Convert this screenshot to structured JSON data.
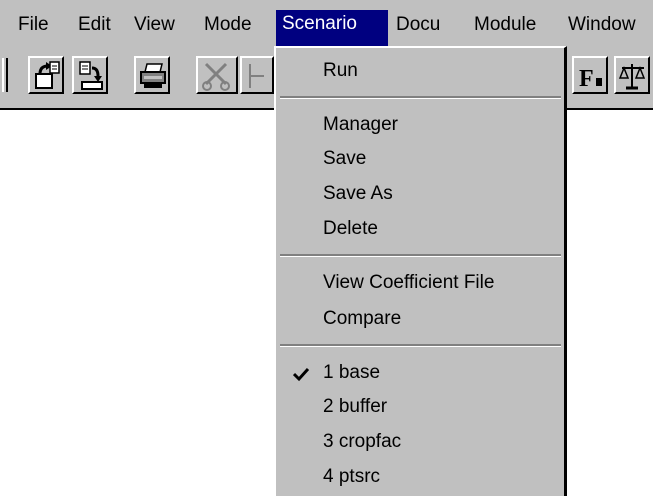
{
  "menubar": {
    "items": [
      {
        "label": "File"
      },
      {
        "label": "Edit"
      },
      {
        "label": "View"
      },
      {
        "label": "Mode"
      },
      {
        "label": "Scenario"
      },
      {
        "label": "Docu"
      },
      {
        "label": "Module"
      },
      {
        "label": "Window"
      }
    ]
  },
  "toolbar": {
    "icons": [
      "file-open-icon",
      "file-save-icon",
      "print-icon",
      "cut-icon",
      "function-icon",
      "balance-scale-icon"
    ]
  },
  "scenario_menu": {
    "items": [
      {
        "label": "Run"
      },
      {
        "label": "Manager"
      },
      {
        "label": "Save"
      },
      {
        "label": "Save As"
      },
      {
        "label": "Delete"
      },
      {
        "label": "View Coefficient File"
      },
      {
        "label": "Compare"
      },
      {
        "label": "1 base",
        "checked": true
      },
      {
        "label": "2 buffer"
      },
      {
        "label": "3 cropfac"
      },
      {
        "label": "4 ptsrc"
      }
    ]
  },
  "colors": {
    "face": "#c0c0c0",
    "highlight": "#000080",
    "shadow": "#808080"
  }
}
